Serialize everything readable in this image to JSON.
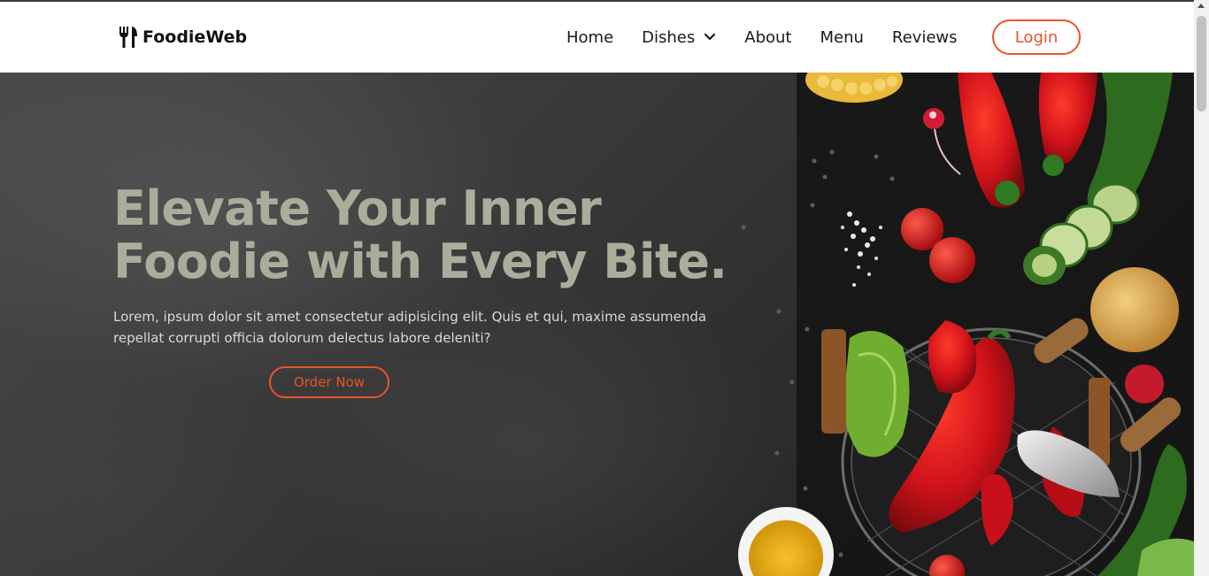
{
  "brand": {
    "name": "FoodieWeb",
    "icon": "fork-knife-icon"
  },
  "nav": {
    "items": [
      {
        "label": "Home"
      },
      {
        "label": "Dishes",
        "has_dropdown": true
      },
      {
        "label": "About"
      },
      {
        "label": "Menu"
      },
      {
        "label": "Reviews"
      }
    ],
    "login_label": "Login"
  },
  "hero": {
    "title_line1": "Elevate Your Inner",
    "title_line2": "Foodie with Every Bite.",
    "description": "Lorem, ipsum dolor sit amet consectetur adipisicing elit. Quis et qui, maxime assumenda repellat corrupti officia dolorum delectus labore deleniti?",
    "cta_label": "Order Now"
  },
  "colors": {
    "accent": "#e8542a",
    "title": "#a9ad9a",
    "hero_bg": "#2d2d2d"
  }
}
